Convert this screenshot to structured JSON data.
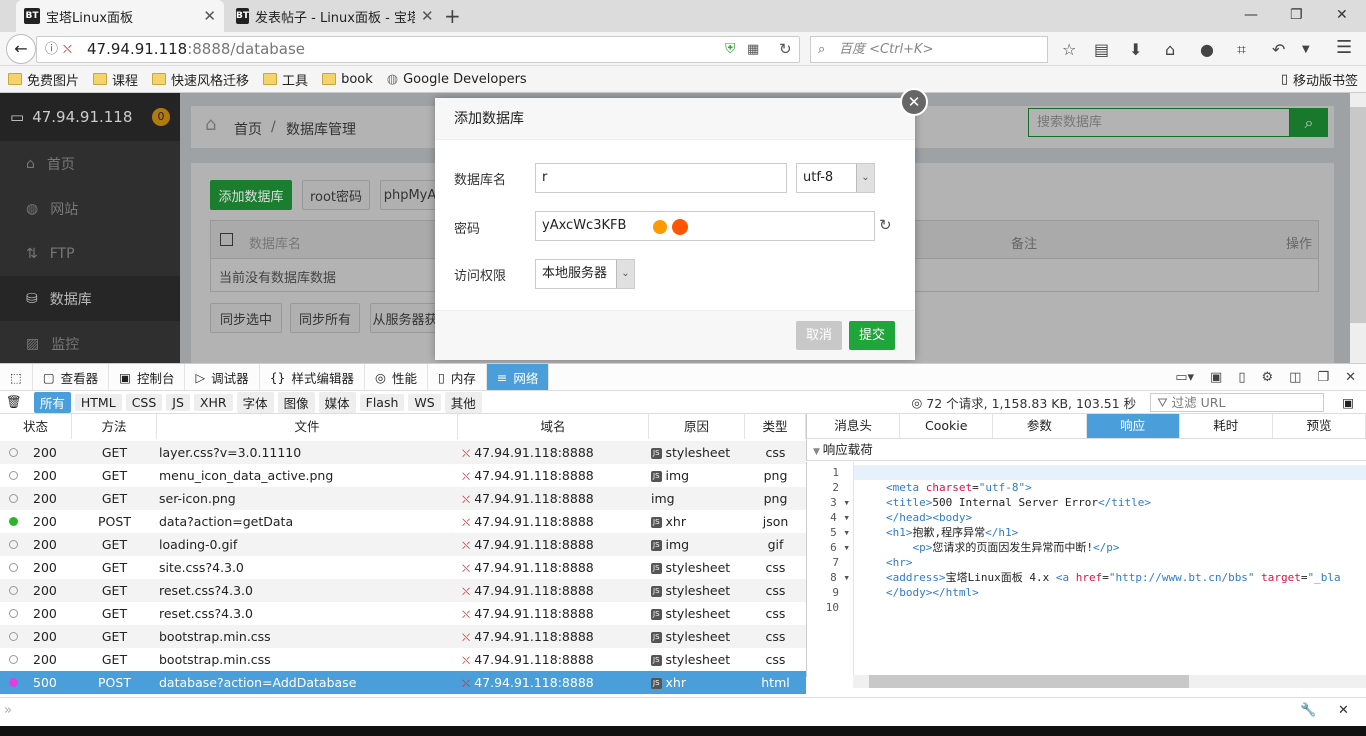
{
  "browser": {
    "tabs": [
      {
        "label": "宝塔Linux面板",
        "icon": "BT",
        "active": true
      },
      {
        "label": "发表帖子 - Linux面板 - 宝塔",
        "icon": "BT",
        "active": false
      }
    ],
    "url_host": "47.94.91.118",
    "url_rest": ":8888/database",
    "search_placeholder": "百度 <Ctrl+K>",
    "bookmarks": [
      "免费图片",
      "课程",
      "快速风格迁移",
      "工具",
      "book",
      "Google Developers"
    ],
    "mobile_bookmarks": "移动版书签"
  },
  "panel": {
    "server": "47.94.91.118",
    "badge": "0",
    "sidebar": [
      "首页",
      "网站",
      "FTP",
      "数据库",
      "监控"
    ],
    "breadcrumb": [
      "首页",
      "/",
      "数据库管理"
    ],
    "search_placeholder": "搜索数据库",
    "buttons": [
      "添加数据库",
      "root密码",
      "phpMyA"
    ],
    "table_headers": [
      "数据库名",
      "备注",
      "操作"
    ],
    "empty_text": "当前没有数据库数据",
    "bottom_buttons": [
      "同步选中",
      "同步所有",
      "从服务器获"
    ],
    "accent": "#20a53a"
  },
  "modal": {
    "title": "添加数据库",
    "name_label": "数据库名",
    "name_value": "r",
    "charset": "utf-8",
    "password_label": "密码",
    "password_value": "yAxcWc3KFB",
    "access_label": "访问权限",
    "access_value": "本地服务器",
    "cancel": "取消",
    "submit": "提交"
  },
  "devtools": {
    "tabs": [
      "查看器",
      "控制台",
      "调试器",
      "样式编辑器",
      "性能",
      "内存",
      "网络"
    ],
    "filters": [
      "所有",
      "HTML",
      "CSS",
      "JS",
      "XHR",
      "字体",
      "图像",
      "媒体",
      "Flash",
      "WS",
      "其他"
    ],
    "summary": "72 个请求, 1,158.83 KB, 103.51 秒",
    "filter_placeholder": "过滤 URL",
    "columns": [
      "状态",
      "方法",
      "文件",
      "域名",
      "原因",
      "类型"
    ],
    "requests": [
      {
        "status": "200",
        "method": "GET",
        "file": "layer.css?v=3.0.11110",
        "domain": "47.94.91.118:8888",
        "cause": "stylesheet",
        "type": "css",
        "js": true
      },
      {
        "status": "200",
        "method": "GET",
        "file": "menu_icon_data_active.png",
        "domain": "47.94.91.118:8888",
        "cause": "img",
        "type": "png",
        "js": true
      },
      {
        "status": "200",
        "method": "GET",
        "file": "ser-icon.png",
        "domain": "47.94.91.118:8888",
        "cause": "img",
        "type": "png",
        "js": false
      },
      {
        "status": "200",
        "method": "POST",
        "file": "data?action=getData",
        "domain": "47.94.91.118:8888",
        "cause": "xhr",
        "type": "json",
        "js": true,
        "dot": "#2bb52b"
      },
      {
        "status": "200",
        "method": "GET",
        "file": "loading-0.gif",
        "domain": "47.94.91.118:8888",
        "cause": "img",
        "type": "gif",
        "js": true
      },
      {
        "status": "200",
        "method": "GET",
        "file": "site.css?4.3.0",
        "domain": "47.94.91.118:8888",
        "cause": "stylesheet",
        "type": "css",
        "js": true
      },
      {
        "status": "200",
        "method": "GET",
        "file": "reset.css?4.3.0",
        "domain": "47.94.91.118:8888",
        "cause": "stylesheet",
        "type": "css",
        "js": true
      },
      {
        "status": "200",
        "method": "GET",
        "file": "reset.css?4.3.0",
        "domain": "47.94.91.118:8888",
        "cause": "stylesheet",
        "type": "css",
        "js": true
      },
      {
        "status": "200",
        "method": "GET",
        "file": "bootstrap.min.css",
        "domain": "47.94.91.118:8888",
        "cause": "stylesheet",
        "type": "css",
        "js": true
      },
      {
        "status": "200",
        "method": "GET",
        "file": "bootstrap.min.css",
        "domain": "47.94.91.118:8888",
        "cause": "stylesheet",
        "type": "css",
        "js": true
      },
      {
        "status": "500",
        "method": "POST",
        "file": "database?action=AddDatabase",
        "domain": "47.94.91.118:8888",
        "cause": "xhr",
        "type": "html",
        "js": true,
        "dot": "#e040e0",
        "selected": true
      }
    ],
    "detail_tabs": [
      "消息头",
      "Cookie",
      "参数",
      "响应",
      "耗时",
      "预览"
    ],
    "payload_label": "响应载荷",
    "code_lines": [
      "",
      "<meta charset=\"utf-8\">",
      "<title>500 Internal Server Error</title>",
      "</head><body>",
      "<h1>抱歉,程序异常</h1>",
      "    <p>您请求的页面因发生异常而中断!</p>",
      "<hr>",
      "<address>宝塔Linux面板 4.x <a href=\"http://www.bt.cn/bbs\" target=\"_bla",
      "</body></html>",
      ""
    ],
    "selected_color": "#4a9fda"
  }
}
